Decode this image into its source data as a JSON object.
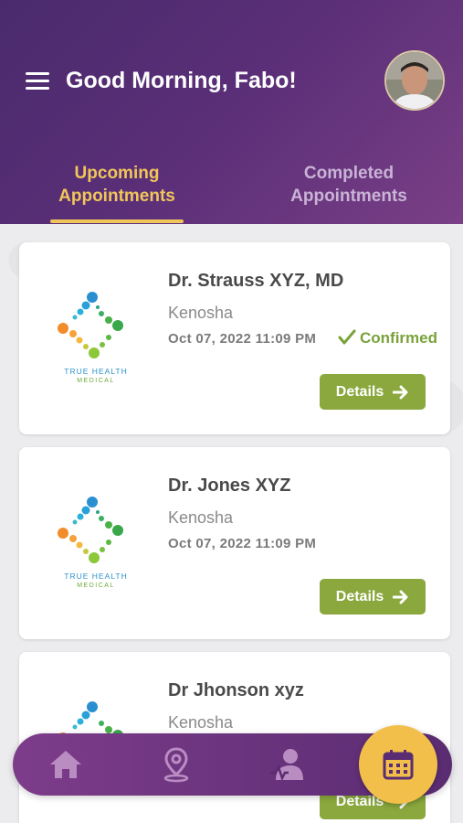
{
  "header": {
    "greeting": "Good Morning, Fabo!",
    "tabs": [
      {
        "label": "Upcoming Appointments",
        "active": true
      },
      {
        "label": "Completed Appointments",
        "active": false
      }
    ]
  },
  "logo": {
    "line1": "TRUE HEALTH",
    "line2": "MEDICAL"
  },
  "appointments": [
    {
      "doctor": "Dr. Strauss XYZ, MD",
      "location": "Kenosha",
      "datetime": "Oct 07, 2022 11:09 PM",
      "status": "Confirmed",
      "action": "Details"
    },
    {
      "doctor": "Dr. Jones XYZ",
      "location": "Kenosha",
      "datetime": "Oct 07, 2022 11:09 PM",
      "status": "",
      "action": "Details"
    },
    {
      "doctor": "Dr Jhonson xyz",
      "location": "Kenosha",
      "datetime": "",
      "status": "",
      "action": "Details"
    }
  ],
  "bottom_nav": {
    "items": [
      "home-icon",
      "location-pin-icon",
      "doctor-icon",
      "calendar-icon"
    ],
    "active": "calendar-icon"
  },
  "colors": {
    "header": "#5b2f78",
    "accent_tab": "#f0c65a",
    "button": "#8aa83d",
    "confirmed": "#79a23a",
    "fab": "#f2c04a"
  }
}
